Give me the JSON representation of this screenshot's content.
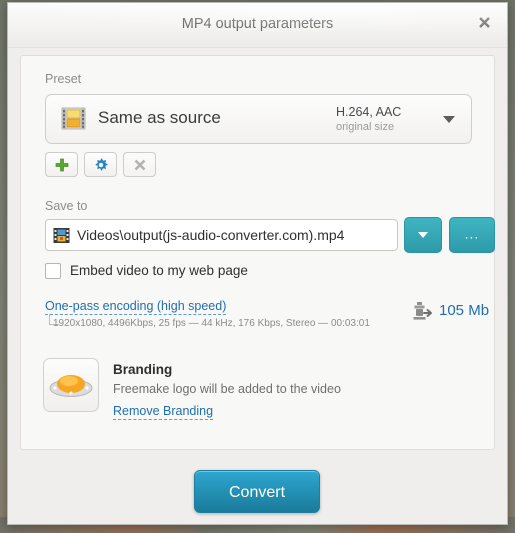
{
  "window": {
    "title": "MP4 output parameters",
    "close_icon": "close-icon"
  },
  "preset": {
    "label": "Preset",
    "icon": "film-strip-icon",
    "name": "Same as source",
    "codec": "H.264, AAC",
    "size": "original size",
    "dropdown_icon": "chevron-down-icon",
    "buttons": [
      {
        "name": "add-preset",
        "icon": "plus-icon",
        "label": "+"
      },
      {
        "name": "edit-preset",
        "icon": "gear-icon",
        "label": "⚙"
      },
      {
        "name": "delete-preset",
        "icon": "close-x-icon",
        "label": "✖"
      }
    ]
  },
  "save_to": {
    "label": "Save to",
    "file_icon": "media-file-icon",
    "path": "Videos\\output(js-audio-converter.com).mp4",
    "dropdown_icon": "chevron-down-icon",
    "browse_label": "...",
    "embed_checkbox_label": "Embed video to my web page",
    "embed_checked": false
  },
  "encoding": {
    "link": "One-pass encoding (high speed)",
    "details": "1920x1080, 4496Kbps, 25 fps — 44 kHz, 176 Kbps, Stereo — 00:03:01",
    "size_icon": "compress-export-icon",
    "size_value": "105 Mb"
  },
  "branding": {
    "icon": "freemake-logo-icon",
    "title": "Branding",
    "description": "Freemake logo will be added to the video",
    "remove_link": "Remove Branding"
  },
  "footer": {
    "convert_label": "Convert"
  },
  "colors": {
    "accent_blue": "#1f6fae",
    "teal": "#2e9aa9",
    "convert_blue": "#2390b4",
    "orange": "#f5a623",
    "green": "#5aa832",
    "gear_blue": "#2283c4"
  }
}
